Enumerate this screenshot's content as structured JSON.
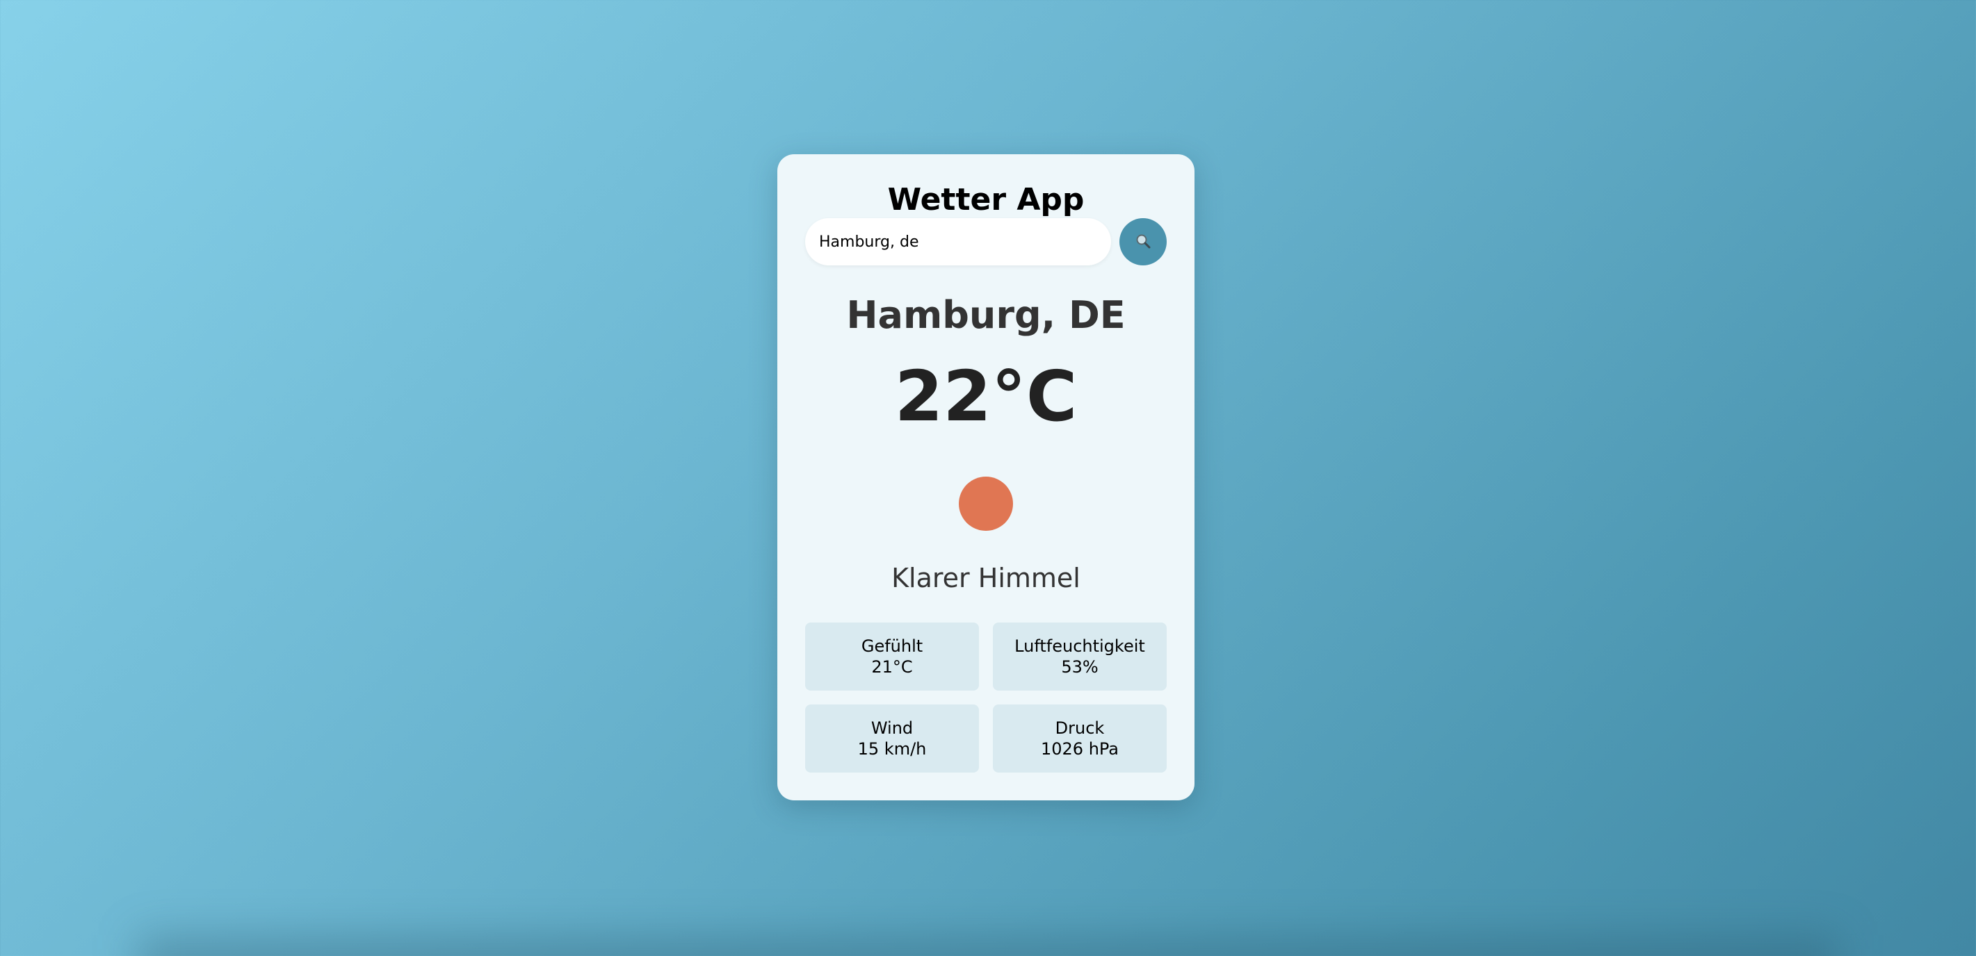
{
  "app": {
    "title": "Wetter App"
  },
  "search": {
    "value": "Hamburg, de",
    "button_icon": "search-icon"
  },
  "weather": {
    "city": "Hamburg, DE",
    "temperature": "22°C",
    "icon": "sun-icon",
    "icon_color": "#e07653",
    "description": "Klarer Himmel"
  },
  "details": [
    {
      "label": "Gefühlt",
      "value": "21°C"
    },
    {
      "label": "Luftfeuchtigkeit",
      "value": "53%"
    },
    {
      "label": "Wind",
      "value": "15 km/h"
    },
    {
      "label": "Druck",
      "value": "1026 hPa"
    }
  ],
  "colors": {
    "accent": "#4a93ad",
    "card_background": "#eef7fa",
    "detail_background": "#d9eaf0"
  }
}
